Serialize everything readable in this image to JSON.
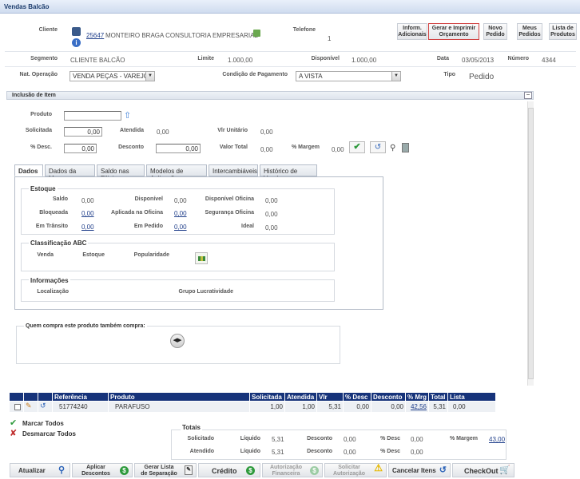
{
  "window": {
    "title": "Vendas Balcão"
  },
  "header": {
    "cliente_label": "Cliente",
    "cliente_code": "25647",
    "cliente_name": "MONTEIRO BRAGA CONSULTORIA EMPRESARIAL",
    "telefone_label": "Telefone",
    "telefone_value": "1",
    "segmento_label": "Segmento",
    "segmento_value": "CLIENTE BALCÃO",
    "limite_label": "Limite",
    "limite_value": "1.000,00",
    "disponivel_label": "Disponível",
    "disponivel_value": "1.000,00",
    "data_label": "Data",
    "data_value": "03/05/2013",
    "numero_label": "Número",
    "numero_value": "4344",
    "nat_label": "Nat. Operação",
    "nat_value": "VENDA PEÇAS - VAREJO",
    "cond_label": "Condição de Pagamento",
    "cond_value": "A VISTA",
    "tipo_label": "Tipo",
    "tipo_value": "Pedido"
  },
  "top_buttons": {
    "inform_l1": "Inform.",
    "inform_l2": "Adicionais",
    "gerar_l1": "Gerar e Imprimir",
    "gerar_l2": "Orçamento",
    "novo_l1": "Novo",
    "novo_l2": "Pedido",
    "meus_l1": "Meus",
    "meus_l2": "Pedidos",
    "lista_l1": "Lista de",
    "lista_l2": "Produtos"
  },
  "inclusao": {
    "title": "Inclusão de Item",
    "produto_label": "Produto",
    "produto_value": "",
    "solicitada_label": "Solicitada",
    "solicitada_value": "0,00",
    "atendida_label": "Atendida",
    "atendida_value": "0,00",
    "vlr_unit_label": "Vlr Unitário",
    "vlr_unit_value": "0,00",
    "desc_pct_label": "% Desc.",
    "desc_pct_value": "0,00",
    "desconto_label": "Desconto",
    "desconto_value": "0,00",
    "valor_total_label": "Valor Total",
    "valor_total_value": "0,00",
    "margem_label": "% Margem",
    "margem_value": "0,00"
  },
  "tabs": {
    "t1": "Dados",
    "t2": "Dados da Marca",
    "t3": "Saldo nas Filiais",
    "t4": "Modelos de Aplicação",
    "t5": "Intercambiáveis",
    "t6": "Histórico de Vendas"
  },
  "estoque": {
    "title": "Estoque",
    "saldo_label": "Saldo",
    "saldo_value": "0,00",
    "disp_label": "Disponível",
    "disp_value": "0,00",
    "disp_of_label": "Disponível Oficina",
    "disp_of_value": "0,00",
    "bloq_label": "Bloqueada",
    "bloq_value": "0,00",
    "aplic_label": "Aplicada na Oficina",
    "aplic_value": "0,00",
    "seg_label": "Segurança Oficina",
    "seg_value": "0,00",
    "trans_label": "Em Trânsito",
    "trans_value": "0,00",
    "pedido_label": "Em Pedido",
    "pedido_value": "0,00",
    "ideal_label": "Ideal",
    "ideal_value": "0,00"
  },
  "abc": {
    "title": "Classificação ABC",
    "venda_label": "Venda",
    "estoque_label": "Estoque",
    "pop_label": "Popularidade"
  },
  "info": {
    "title": "Informações",
    "local_label": "Localização",
    "grupo_label": "Grupo Lucratividade"
  },
  "quem_compra": {
    "title": "Quem compra este produto também compra:"
  },
  "grid": {
    "headers": [
      "Referência",
      "Produto",
      "Solicitada",
      "Atendida",
      "Vlr Unit",
      "% Desc",
      "Desconto",
      "% Mrg",
      "Total",
      "Lista"
    ],
    "row": {
      "ref": "51774240",
      "produto": "PARAFUSO",
      "solicitada": "1,00",
      "atendida": "1,00",
      "vlr_unit": "5,31",
      "desc_pct": "0,00",
      "desconto": "0,00",
      "mrg": "42,56",
      "total": "5,31",
      "lista": "0,00"
    }
  },
  "marcar_todos": "Marcar Todos",
  "desmarcar_todos": "Desmarcar Todos",
  "totais": {
    "title": "Totais",
    "solicitado_label": "Solicitado",
    "atendido_label": "Atendido",
    "liquido_label": "Líquido",
    "desconto_label": "Desconto",
    "desc_pct_label": "% Desc",
    "margem_label": "% Margem",
    "sol_liquido": "5,31",
    "sol_desconto": "0,00",
    "sol_desc_pct": "0,00",
    "sol_margem": "43,00",
    "at_liquido": "5,31",
    "at_desconto": "0,00",
    "at_desc_pct": "0,00"
  },
  "bottom_buttons": {
    "atualizar": "Atualizar",
    "aplicar_l1": "Aplicar",
    "aplicar_l2": "Descontos",
    "gerar_l1": "Gerar Lista",
    "gerar_l2": "de Separação",
    "credito": "Crédito",
    "autfin_l1": "Autorização",
    "autfin_l2": "Financeira",
    "solaut_l1": "Solicitar",
    "solaut_l2": "Autorização",
    "cancelar": "Cancelar Itens",
    "checkout": "CheckOut"
  },
  "colors": {
    "header_blue": "#16337a",
    "accent_green": "#2e9a3c",
    "link_blue": "#1f3e8a"
  }
}
